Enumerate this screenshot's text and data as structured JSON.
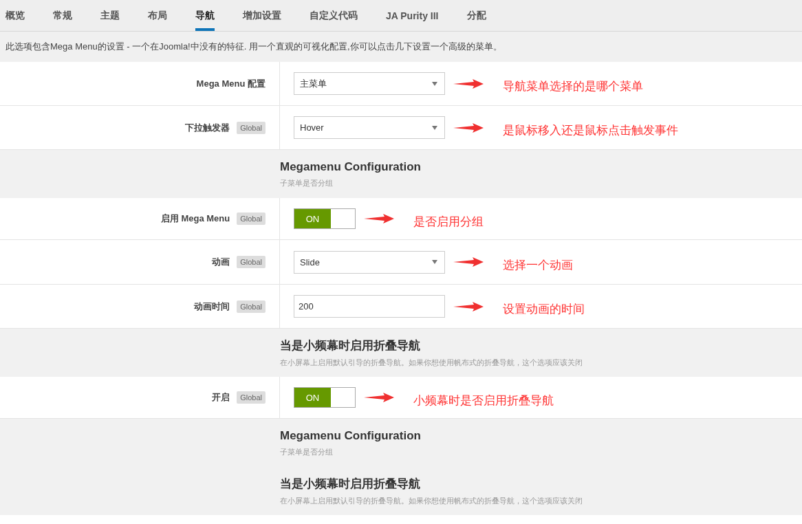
{
  "tabs": [
    {
      "label": "概览",
      "selected": false
    },
    {
      "label": "常规",
      "selected": false
    },
    {
      "label": "主题",
      "selected": false
    },
    {
      "label": "布局",
      "selected": false
    },
    {
      "label": "导航",
      "selected": true
    },
    {
      "label": "增加设置",
      "selected": false
    },
    {
      "label": "自定义代码",
      "selected": false
    },
    {
      "label": "JA Purity III",
      "selected": false
    },
    {
      "label": "分配",
      "selected": false
    }
  ],
  "description": "此选项包含Mega Menu的设置 - 一个在Joomla!中没有的特征. 用一个直观的可视化配置,你可以点击几下设置一个高级的菜单。",
  "rows": [
    {
      "kind": "select",
      "label": "Mega Menu 配置",
      "value": "主菜单",
      "note": "导航菜单选择的是哪个菜单"
    },
    {
      "kind": "select",
      "label": "下拉触发器",
      "badge": "Global",
      "value": "Hover",
      "note": "是鼠标移入还是鼠标点击触发事件"
    },
    {
      "kind": "section",
      "title": "Megamenu Configuration",
      "subtitle": "子菜单是否分组"
    },
    {
      "kind": "toggle",
      "label": "启用 Mega Menu",
      "badge": "Global",
      "on": true,
      "value": "ON",
      "note": "是否启用分组"
    },
    {
      "kind": "select",
      "label": "动画",
      "badge": "Global",
      "value": "Slide",
      "note": "选择一个动画"
    },
    {
      "kind": "text",
      "label": "动画时间",
      "badge": "Global",
      "value": "200",
      "note": "设置动画的时间"
    },
    {
      "kind": "section",
      "title": "当是小频幕时启用折叠导航",
      "subtitle": "在小屏幕上启用默认引导的折叠导航。如果你想使用帆布式的折叠导航，这个选项应该关闭"
    },
    {
      "kind": "toggle",
      "label": "开启",
      "badge": "Global",
      "on": true,
      "value": "ON",
      "note": "小频幕时是否启用折叠导航"
    },
    {
      "kind": "section",
      "title": "Megamenu Configuration",
      "subtitle": "子菜单是否分组"
    },
    {
      "kind": "section",
      "title": "当是小频幕时启用折叠导航",
      "subtitle": "在小屏幕上启用默认引导的折叠导航。如果你想使用帆布式的折叠导航，这个选项应该关闭"
    }
  ]
}
